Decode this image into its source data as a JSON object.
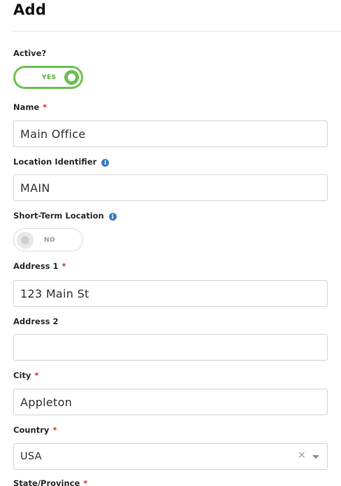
{
  "page": {
    "title": "Add"
  },
  "form": {
    "active": {
      "label": "Active?",
      "toggle_text": "YES",
      "value": true
    },
    "name": {
      "label": "Name",
      "value": "Main Office",
      "required": "*"
    },
    "location_identifier": {
      "label": "Location Identifier",
      "value": "MAIN",
      "info": "i"
    },
    "short_term_location": {
      "label": "Short-Term Location",
      "toggle_text": "NO",
      "value": false,
      "info": "i"
    },
    "address1": {
      "label": "Address 1",
      "value": "123 Main St",
      "required": "*"
    },
    "address2": {
      "label": "Address 2",
      "value": ""
    },
    "city": {
      "label": "City",
      "value": "Appleton",
      "required": "*"
    },
    "country": {
      "label": "Country",
      "value": "USA",
      "required": "*",
      "clear_glyph": "×"
    },
    "state": {
      "label": "State/Province",
      "required": "*"
    }
  },
  "colors": {
    "toggle_on": "#6cbf4f",
    "required": "#d9342b",
    "info": "#3a7cc4"
  },
  "icons": [
    "info-icon",
    "clear-icon",
    "chevron-down-icon"
  ]
}
